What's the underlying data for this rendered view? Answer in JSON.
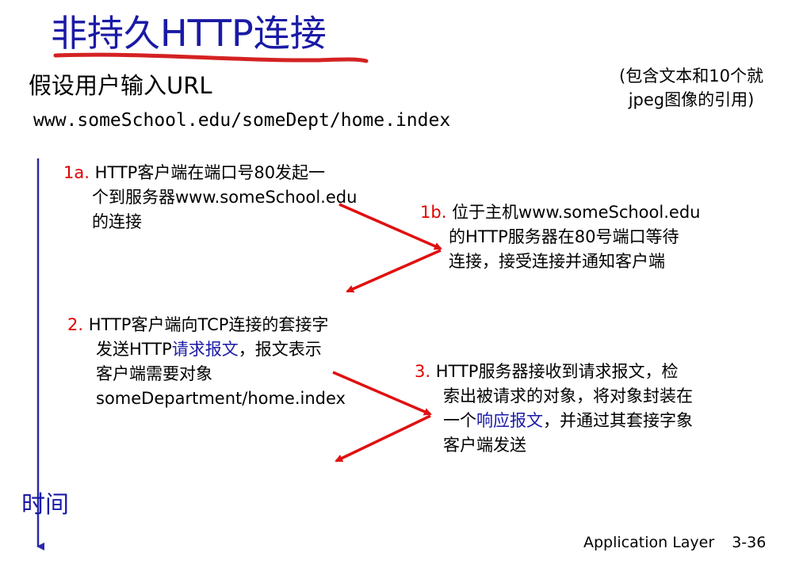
{
  "title": "非持久HTTP连接",
  "intro": {
    "subtitle": "假设用户输入URL",
    "url": "www.someSchool.edu/someDept/home.index",
    "note_line1": "(包含文本和10个就",
    "note_line2": "jpeg图像的引用)"
  },
  "steps": [
    {
      "num": "1a.",
      "lines": [
        "HTTP客户端在端口号80发起一",
        "个到服务器www.someSchool.edu",
        "的连接"
      ]
    },
    {
      "num": "1b.",
      "lines": [
        "位于主机www.someSchool.edu",
        "的HTTP服务器在80号端口等待",
        "连接，接受连接并通知客户端"
      ]
    },
    {
      "num": "2.",
      "line1": "HTTP客户端向TCP连接的套接字",
      "line2_pre": "发送HTTP",
      "line2_link": "请求报文",
      "line2_post": "，报文表示",
      "line3": "客户端需要对象",
      "line4": "someDepartment/home.index"
    },
    {
      "num": "3.",
      "line1": "HTTP服务器接收到请求报文，检",
      "line2": "索出被请求的对象，将对象封装在",
      "line3_pre": "一个",
      "line3_link": "响应报文",
      "line3_post": "，并通过其套接字象",
      "line4": "客户端发送"
    }
  ],
  "time_label": "时间",
  "footer": {
    "section": "Application Layer",
    "page": "3-36"
  },
  "colors": {
    "title": "#1a1aa6",
    "underline": "#d42222",
    "step_number": "#e00000",
    "arrow": "#e01010",
    "timeline": "#2a2aa8",
    "link_text": "#1a1aa6"
  }
}
